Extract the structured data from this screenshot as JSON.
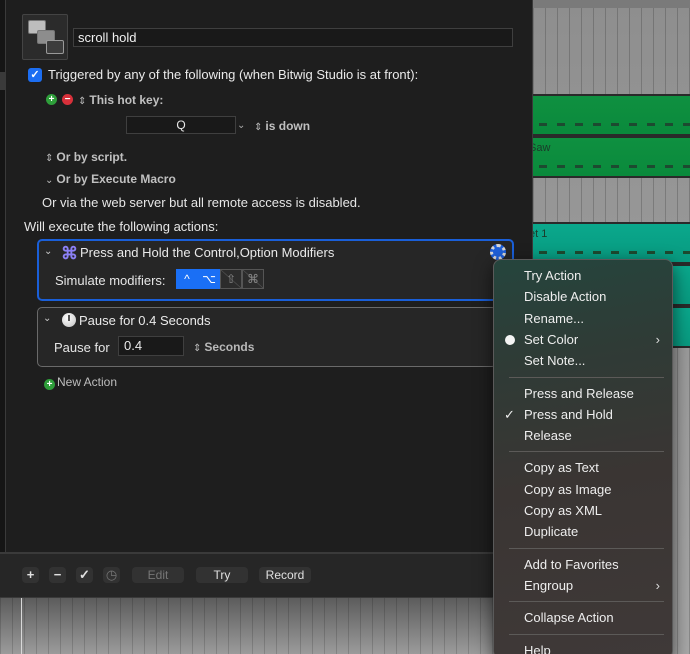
{
  "editor": {
    "macro_name": "scroll hold",
    "trigger": {
      "checked": true,
      "label": "Triggered by any of the following (when Bitwig Studio is at front):",
      "hot_key_label": "This hot key:",
      "key_value": "Q",
      "key_state": "is down",
      "by_script": "Or by script.",
      "by_execute_macro": "Or by Execute Macro",
      "web_server_note": "Or via the web server but all remote access is disabled."
    },
    "actions_heading": "Will execute the following actions:",
    "actions": [
      {
        "title": "Press and Hold the Control,Option Modifiers",
        "icon": "command-icon",
        "selected": true,
        "simulate_label": "Simulate modifiers:",
        "modifiers": [
          {
            "name": "control",
            "glyph": "^",
            "on": true
          },
          {
            "name": "option",
            "glyph": "⌥",
            "on": true
          },
          {
            "name": "shift",
            "glyph": "⇧",
            "on": false
          },
          {
            "name": "command",
            "glyph": "⌘",
            "on": false
          }
        ]
      },
      {
        "title": "Pause for 0.4 Seconds",
        "icon": "clock-icon",
        "selected": false,
        "pause_label": "Pause for",
        "pause_value": "0.4",
        "unit": "Seconds"
      }
    ],
    "new_action_label": "New Action"
  },
  "toolbar": {
    "add": "+",
    "remove": "−",
    "check": "✓",
    "clock": "◷",
    "edit": "Edit",
    "try": "Try",
    "record": "Record"
  },
  "daw": {
    "lane_labels": [
      "Saw",
      "et 1"
    ]
  },
  "context_menu": {
    "groups": [
      [
        {
          "label": "Try Action"
        },
        {
          "label": "Disable Action"
        },
        {
          "label": "Rename..."
        },
        {
          "label": "Set Color",
          "dot": true,
          "submenu": true
        },
        {
          "label": "Set Note..."
        }
      ],
      [
        {
          "label": "Press and Release"
        },
        {
          "label": "Press and Hold",
          "checked": true
        },
        {
          "label": "Release"
        }
      ],
      [
        {
          "label": "Copy as Text"
        },
        {
          "label": "Copy as Image"
        },
        {
          "label": "Copy as XML"
        },
        {
          "label": "Duplicate"
        }
      ],
      [
        {
          "label": "Add to Favorites"
        },
        {
          "label": "Engroup",
          "submenu": true
        }
      ],
      [
        {
          "label": "Collapse Action"
        }
      ],
      [
        {
          "label": "Help"
        }
      ]
    ],
    "check_glyph": "✓",
    "submenu_glyph": "›"
  }
}
